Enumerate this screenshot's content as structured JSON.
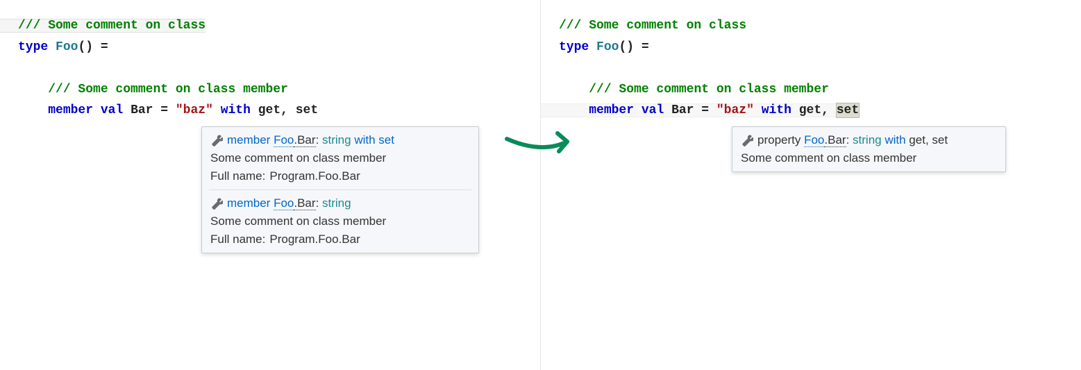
{
  "code": {
    "comment_class": "/// Some comment on class",
    "kw_type": "type",
    "type_name": "Foo",
    "parens_eq": "() =",
    "comment_member": "/// Some comment on class member",
    "kw_member": "member",
    "kw_val": "val",
    "ident_bar": "Bar",
    "eq": " = ",
    "str_baz": "\"baz\"",
    "kw_with": "with",
    "ident_get": "get",
    "comma": ", ",
    "ident_set": "set"
  },
  "tooltip_left": {
    "sig1_prefix": "member ",
    "sig1_link": "Foo",
    "sig1_dot": ".Bar",
    "sig1_colon": ": ",
    "sig1_type": "string",
    "sig1_with": " with ",
    "sig1_accessor": "set",
    "desc": "Some comment on class member",
    "fullname_label": "Full name: ",
    "fullname_value": "Program.Foo.Bar",
    "sig2_prefix": "member ",
    "sig2_link": "Foo",
    "sig2_dot": ".Bar",
    "sig2_colon": ": ",
    "sig2_type": "string"
  },
  "tooltip_right": {
    "sig_prefix": "property ",
    "sig_link": "Foo",
    "sig_dot": ".Bar",
    "sig_colon": ": ",
    "sig_type": "string",
    "sig_with": " with ",
    "sig_get": "get",
    "sig_comma": ", ",
    "sig_set": "set",
    "desc": "Some comment on class member"
  },
  "colors": {
    "comment": "#008000",
    "keyword": "#0000cc",
    "type": "#1e7a8c",
    "string": "#a31515",
    "tooltip_bg": "#f5f7fa",
    "arrow": "#0b8a5a"
  }
}
